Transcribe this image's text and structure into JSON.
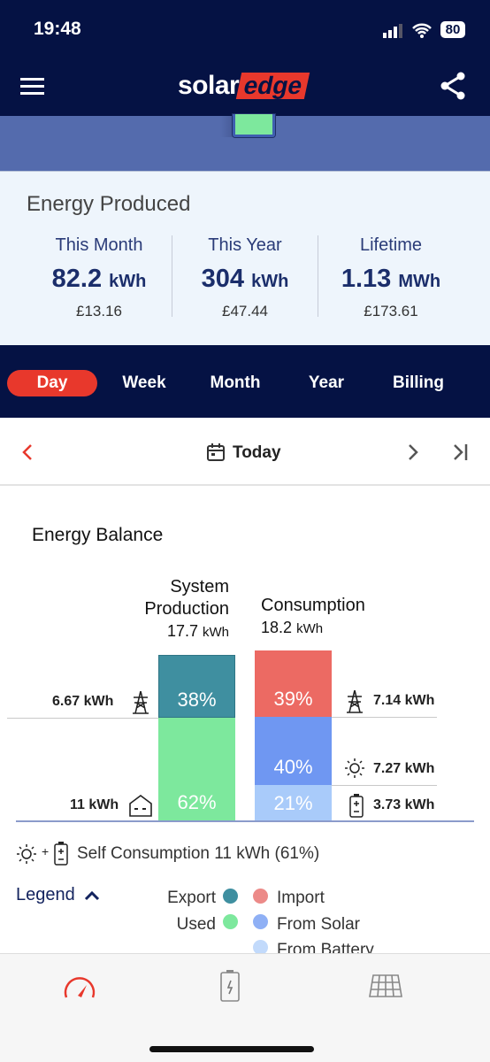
{
  "status_bar": {
    "time": "19:48",
    "battery": "80"
  },
  "header": {
    "logo_left": "solar",
    "logo_right": "edge",
    "menu_icon": "hamburger-icon",
    "share_icon": "share-icon"
  },
  "energy_produced": {
    "title": "Energy Produced",
    "stats": [
      {
        "label": "This Month",
        "value": "82.2",
        "unit": "kWh",
        "money": "£13.16"
      },
      {
        "label": "This Year",
        "value": "304",
        "unit": "kWh",
        "money": "£47.44"
      },
      {
        "label": "Lifetime",
        "value": "1.13",
        "unit": "MWh",
        "money": "£173.61"
      }
    ]
  },
  "tabs": [
    {
      "label": "Day",
      "active": true
    },
    {
      "label": "Week"
    },
    {
      "label": "Month"
    },
    {
      "label": "Year"
    },
    {
      "label": "Billing"
    }
  ],
  "date_nav": {
    "label": "Today"
  },
  "energy_balance": {
    "title": "Energy Balance",
    "production": {
      "title_line1": "System",
      "title_line2": "Production",
      "value": "17.7",
      "unit": "kWh",
      "export_pct": "38%",
      "used_pct": "62%",
      "export_value": "6.67 kWh",
      "used_value": "11 kWh"
    },
    "consumption": {
      "title": "Consumption",
      "value": "18.2",
      "unit": "kWh",
      "import_pct": "39%",
      "solar_pct": "40%",
      "battery_pct": "21%",
      "import_value": "7.14 kWh",
      "solar_value": "7.27 kWh",
      "battery_value": "3.73 kWh"
    },
    "self_consumption": "Self Consumption 11 kWh (61%)",
    "legend_label": "Legend",
    "legend": {
      "export": "Export",
      "used": "Used",
      "import": "Import",
      "from_solar": "From Solar",
      "from_battery": "From Battery"
    }
  },
  "colors": {
    "export": "#3f8fa0",
    "used": "#7de89d",
    "import": "#ec6a63",
    "from_solar": "#6f97f2",
    "from_battery": "#a9cbfa",
    "accent": "#e8382c",
    "navy": "#051244"
  },
  "chart_data": {
    "type": "bar",
    "stacked": true,
    "categories": [
      "System Production",
      "Consumption"
    ],
    "series": [
      {
        "name": "Export",
        "values": [
          6.67,
          0
        ]
      },
      {
        "name": "Used",
        "values": [
          11,
          0
        ]
      },
      {
        "name": "Import",
        "values": [
          0,
          7.14
        ]
      },
      {
        "name": "From Solar",
        "values": [
          0,
          7.27
        ]
      },
      {
        "name": "From Battery",
        "values": [
          0,
          3.73
        ]
      }
    ]
  }
}
